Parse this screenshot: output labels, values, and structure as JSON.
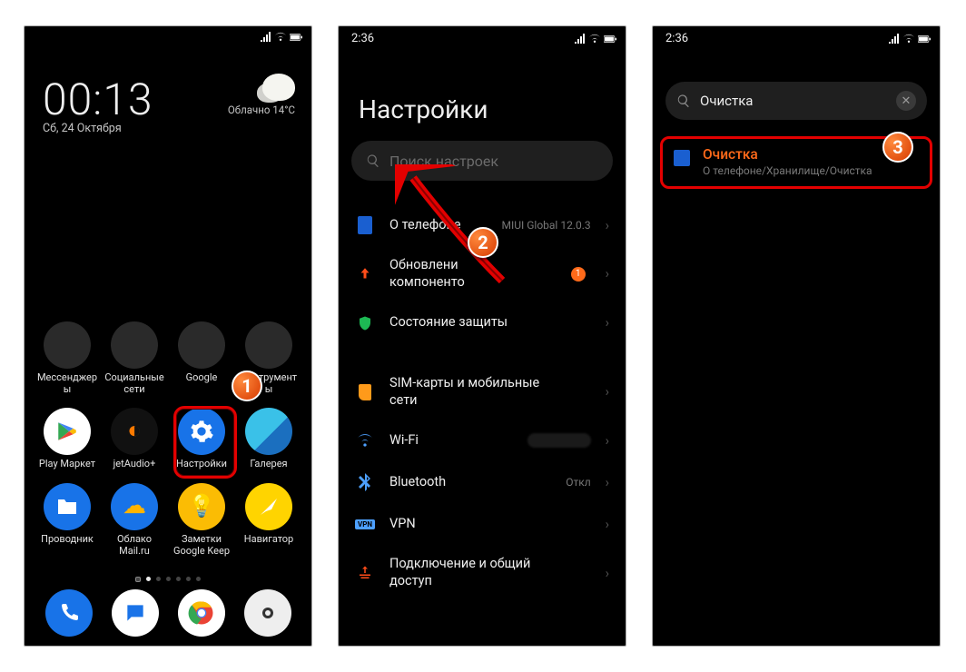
{
  "screen1": {
    "clock": "00:13",
    "date": "Сб, 24 Октября",
    "weather": "Облачно  14°C",
    "folders": [
      "Мессенджер\nы",
      "Социальные\nсети",
      "Google",
      "Инструмент\nы"
    ],
    "apps_row2": [
      "Play Маркет",
      "jetAudio+",
      "Настройки",
      "Галерея"
    ],
    "apps_row3": [
      "Проводник",
      "Облако\nMail.ru",
      "Заметки\nGoogle Keep",
      "Навигатор"
    ]
  },
  "screen2": {
    "time": "2:36",
    "title": "Настройки",
    "search_placeholder": "Поиск настроек",
    "rows": {
      "about": {
        "label": "О телефоне",
        "value": "MIUI Global 12.0.3"
      },
      "update": {
        "label": "Обновлени\nкомпоненто\n",
        "badge": "1"
      },
      "security": {
        "label": "Состояние защиты"
      },
      "sim": {
        "label": "SIM-карты и мобильные\nсети"
      },
      "wifi": {
        "label": "Wi-Fi"
      },
      "bt": {
        "label": "Bluetooth",
        "value": "Откл"
      },
      "vpn": {
        "label": "VPN"
      },
      "share": {
        "label": "Подключение и общий\nдоступ"
      }
    }
  },
  "screen3": {
    "time": "2:36",
    "query": "Очистка",
    "result_title": "Очистка",
    "result_path": "О телефоне/Хранилище/Очистка"
  },
  "steps": {
    "s1": "1",
    "s2": "2",
    "s3": "3"
  }
}
